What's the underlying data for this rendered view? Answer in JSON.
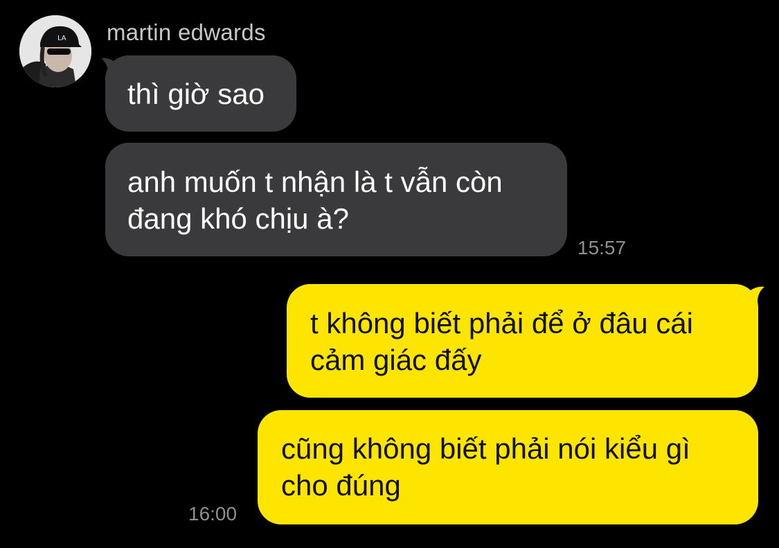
{
  "chat": {
    "sender": {
      "name": "martin edwards",
      "avatar": "profile-photo"
    },
    "incoming": [
      {
        "lines": [
          "thì giờ sao"
        ]
      },
      {
        "lines": [
          "anh muốn t nhận là t vẫn còn",
          "đang khó chịu à?"
        ],
        "time": "15:57"
      }
    ],
    "outgoing": [
      {
        "lines": [
          "t không biết phải để ở đâu cái",
          "cảm giác đấy"
        ]
      },
      {
        "lines": [
          "cũng không biết phải nói kiểu gì",
          "cho đúng"
        ],
        "time": "16:00"
      }
    ]
  },
  "colors": {
    "background": "#000000",
    "incoming_bubble": "#3a3a3c",
    "outgoing_bubble": "#fee500",
    "timestamp": "#8e8e93"
  }
}
